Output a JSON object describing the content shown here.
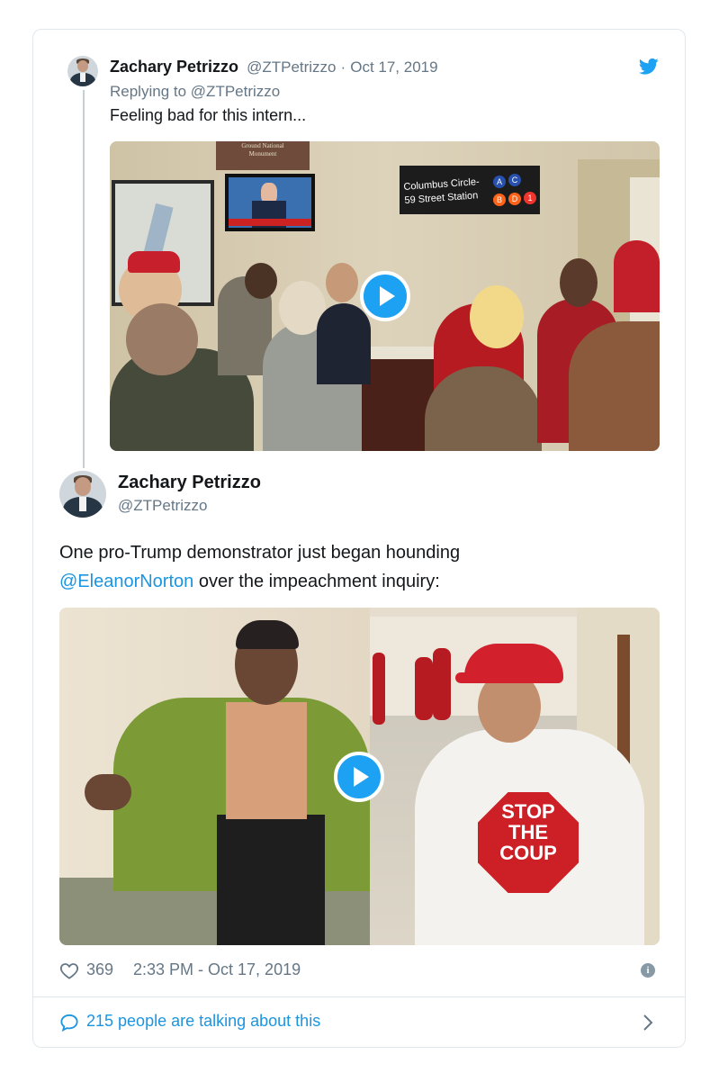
{
  "quoted_tweet": {
    "author_name": "Zachary Petrizzo",
    "author_handle": "@ZTPetrizzo",
    "date_sep": "·",
    "date": "Oct 17, 2019",
    "replying_to_label": "Replying to",
    "replying_to_handle": "@ZTPetrizzo",
    "text": "Feeling bad for this intern...",
    "video": {
      "sign_1": "Ground National",
      "sign_2": "Monument",
      "subway_sign_1": "Columbus Circle-",
      "subway_sign_2": "59 Street Station",
      "subway_lines_top": [
        "A",
        "C"
      ],
      "subway_lines_bottom": [
        "B",
        "D",
        "1"
      ]
    }
  },
  "main_tweet": {
    "author_name": "Zachary Petrizzo",
    "author_handle": "@ZTPetrizzo",
    "text_part1": "One pro-Trump demonstrator just began hounding",
    "mention": "@EleanorNorton",
    "text_part2": " over the impeachment inquiry:",
    "video": {
      "shirt_line_1": "STOP",
      "shirt_line_2": "THE",
      "shirt_line_3": "COUP"
    },
    "likes": "369",
    "timestamp": "2:33 PM - Oct 17, 2019"
  },
  "footer": {
    "talking_label": "215 people are talking about this"
  },
  "icons": {
    "brand": "twitter-bird-icon",
    "like": "heart-icon",
    "info": "info-icon",
    "reply": "speech-bubble-icon",
    "more": "chevron-right-icon"
  },
  "colors": {
    "brand": "#1da1f2",
    "link": "#1b95e0",
    "muted": "#657786",
    "border": "#e1e8ed"
  }
}
